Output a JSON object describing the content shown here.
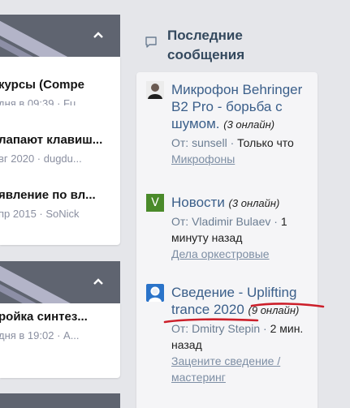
{
  "left_column": {
    "groups": [
      {
        "nodes": [
          {
            "title": "курсы (Compe",
            "meta": "дня в 09:39 · Fu..."
          },
          {
            "title": "лапают клавиш...",
            "meta": "вг 2020 · dugdu..."
          },
          {
            "title": "явление по вл...",
            "meta": "пр 2015 · SoNick"
          }
        ]
      },
      {
        "nodes": [
          {
            "title": "ройка синтез...",
            "meta": "дня в 19:02 · А..."
          }
        ]
      }
    ],
    "collapse_glyph": "⌃"
  },
  "sidebar": {
    "title": "Последние сообщения",
    "icon": "comment-icon",
    "items": [
      {
        "avatar": "avatar-photo",
        "thread": "Микрофон Behringer B2 Pro - борьба с шумом.",
        "online": "(3 онлайн)",
        "from_label": "От:",
        "author": "sunsell",
        "separator": "·",
        "time": "Только что",
        "forum": "Микрофоны"
      },
      {
        "avatar": "avatar-letter",
        "avatar_letter": "V",
        "avatar_color": "#4a8a2a",
        "thread": "Новости",
        "online": "(3 онлайн)",
        "from_label": "От:",
        "author": "Vladimir Bulaev",
        "separator": "·",
        "time": "1 минуту назад",
        "forum": "Дела оркестровые"
      },
      {
        "avatar": "avatar-default",
        "thread": "Сведение - Uplifting trance 2020",
        "online": "(9 онлайн)",
        "from_label": "От:",
        "author": "Dmitry Stepin",
        "separator": "·",
        "time": "2 мин. назад",
        "forum": "Зацените сведение / мастеринг"
      }
    ]
  },
  "colors": {
    "link": "#3b5f8a",
    "muted_link": "#7d8ea4",
    "category_header": "#5f6470",
    "annotation_red": "#cc1f2a"
  }
}
